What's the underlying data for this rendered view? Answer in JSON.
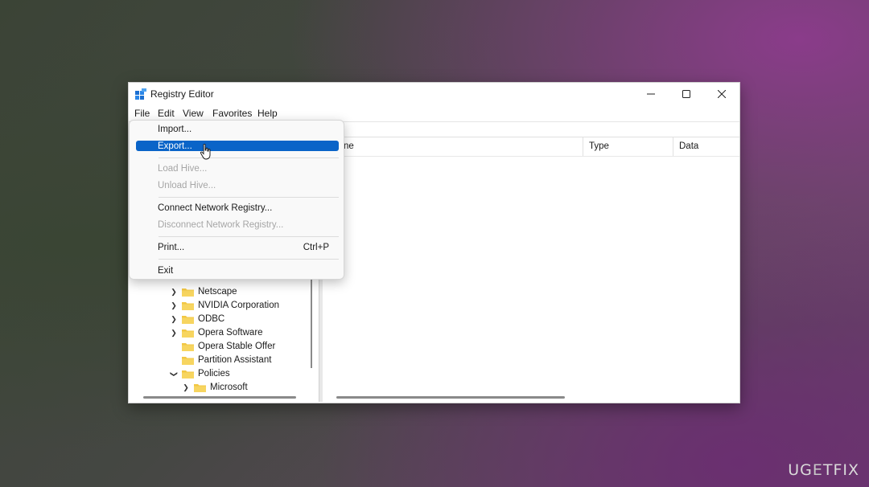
{
  "window": {
    "title": "Registry Editor",
    "menus": [
      "File",
      "Edit",
      "View",
      "Favorites",
      "Help"
    ]
  },
  "file_menu": {
    "items": [
      {
        "label": "Import...",
        "enabled": true,
        "shortcut": ""
      },
      {
        "label": "Export...",
        "enabled": true,
        "highlighted": true,
        "shortcut": ""
      },
      {
        "label": "Load Hive...",
        "enabled": false,
        "shortcut": ""
      },
      {
        "label": "Unload Hive...",
        "enabled": false,
        "shortcut": ""
      },
      {
        "label": "Connect Network Registry...",
        "enabled": true,
        "shortcut": ""
      },
      {
        "label": "Disconnect Network Registry...",
        "enabled": false,
        "shortcut": ""
      },
      {
        "label": "Print...",
        "enabled": true,
        "shortcut": "Ctrl+P"
      },
      {
        "label": "Exit",
        "enabled": true,
        "shortcut": ""
      }
    ]
  },
  "tree": {
    "items": [
      {
        "label": "Netscape",
        "chevron": "right"
      },
      {
        "label": "NVIDIA Corporation",
        "chevron": "right"
      },
      {
        "label": "ODBC",
        "chevron": "right"
      },
      {
        "label": "Opera Software",
        "chevron": "right"
      },
      {
        "label": "Opera Stable Offer",
        "chevron": "none"
      },
      {
        "label": "Partition Assistant",
        "chevron": "none"
      },
      {
        "label": "Policies",
        "chevron": "down"
      },
      {
        "label": "Microsoft",
        "chevron": "right"
      }
    ]
  },
  "list": {
    "columns": [
      "ne",
      "Type",
      "Data"
    ]
  },
  "watermark": {
    "text_a": "UG",
    "text_e": "E",
    "text_b": "TFIX"
  },
  "colors": {
    "highlight": "#0a64c8",
    "folder": "#f2c744",
    "disabled_text": "#a6a6a6"
  }
}
